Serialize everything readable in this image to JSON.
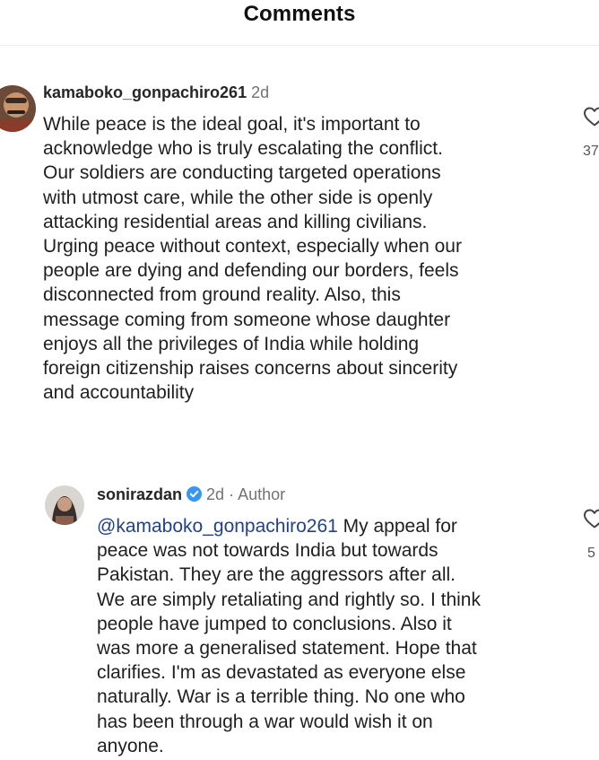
{
  "header": {
    "title": "Comments"
  },
  "comments": [
    {
      "username": "kamaboko_gonpachiro261",
      "time": "2d",
      "lines": [
        "While peace is the ideal goal, it's important to",
        "acknowledge who is truly escalating the conflict.",
        "Our soldiers are conducting targeted operations",
        "with utmost care, while the other side is openly",
        "attacking residential areas and killing civilians.",
        "Urging peace without context, especially when our",
        "people are dying and defending our borders, feels",
        "disconnected from ground reality. Also, this",
        "message coming from someone whose daughter",
        "enjoys all the privileges of India while holding",
        "foreign citizenship raises concerns about sincerity",
        "and accountability"
      ],
      "like_count": "37"
    },
    {
      "username": "sonirazdan",
      "verified": true,
      "time": "2d",
      "author_tag": "· Author",
      "mention": "@kamaboko_gonpachiro261",
      "first_line_rest": " My appeal for",
      "lines": [
        "peace was not towards India but towards",
        "Pakistan. They are the aggressors after all.",
        "We are simply retaliating and rightly so. I think",
        "people have jumped to conclusions. Also it",
        "was more a generalised statement. Hope that",
        "clarifies. I'm as devastated as everyone else",
        "naturally. War is a terrible thing. No one who",
        "has been through a war would wish it on",
        "anyone."
      ],
      "like_count": "5"
    }
  ],
  "colors": {
    "mention": "#23418d",
    "verified_badge": "#3797f0",
    "meta_text": "#737373"
  },
  "icons": [
    "heart-outline-icon",
    "verified-badge-icon"
  ]
}
